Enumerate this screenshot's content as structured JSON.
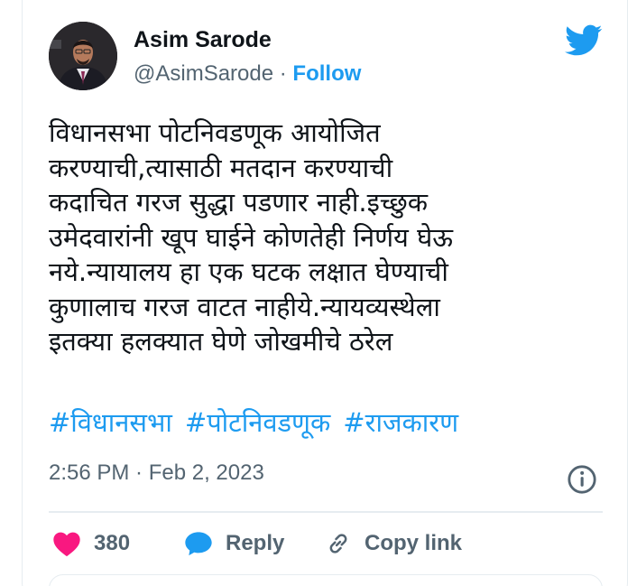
{
  "tweet": {
    "author": {
      "name": "Asim Sarode",
      "handle": "@AsimSarode",
      "separator": " · ",
      "follow_label": "Follow"
    },
    "text": "विधानसभा पोटनिवडणूक आयोजित\nकरण्याची,त्यासाठी मतदान करण्याची\nकदाचित गरज सुद्धा पडणार नाही.इच्छुक\nउमेदवारांनी खूप घाईने कोणतेही निर्णय घेऊ\nनये.न्यायालय हा एक घटक लक्षात घेण्याची\nकुणालाच गरज वाटत नाहीये.न्यायव्यस्थेला\nइतक्या हलक्यात घेणे जोखमीचे ठरेल",
    "hashtags": [
      "#विधानसभा",
      "#पोटनिवडणूक",
      "#राजकारण"
    ],
    "timestamp": "2:56 PM · Feb 2, 2023",
    "actions": {
      "like_count": "380",
      "reply_label": "Reply",
      "copy_link_label": "Copy link"
    }
  },
  "icons": {
    "brand": "twitter-bird-icon",
    "info": "info-icon",
    "like": "heart-icon",
    "reply": "speech-bubble-icon",
    "copy_link": "link-icon"
  },
  "colors": {
    "accent": "#1d9bf0",
    "like": "#f91880",
    "text_primary": "#0f1419",
    "text_secondary": "#536471",
    "border": "#e6ecf0"
  }
}
